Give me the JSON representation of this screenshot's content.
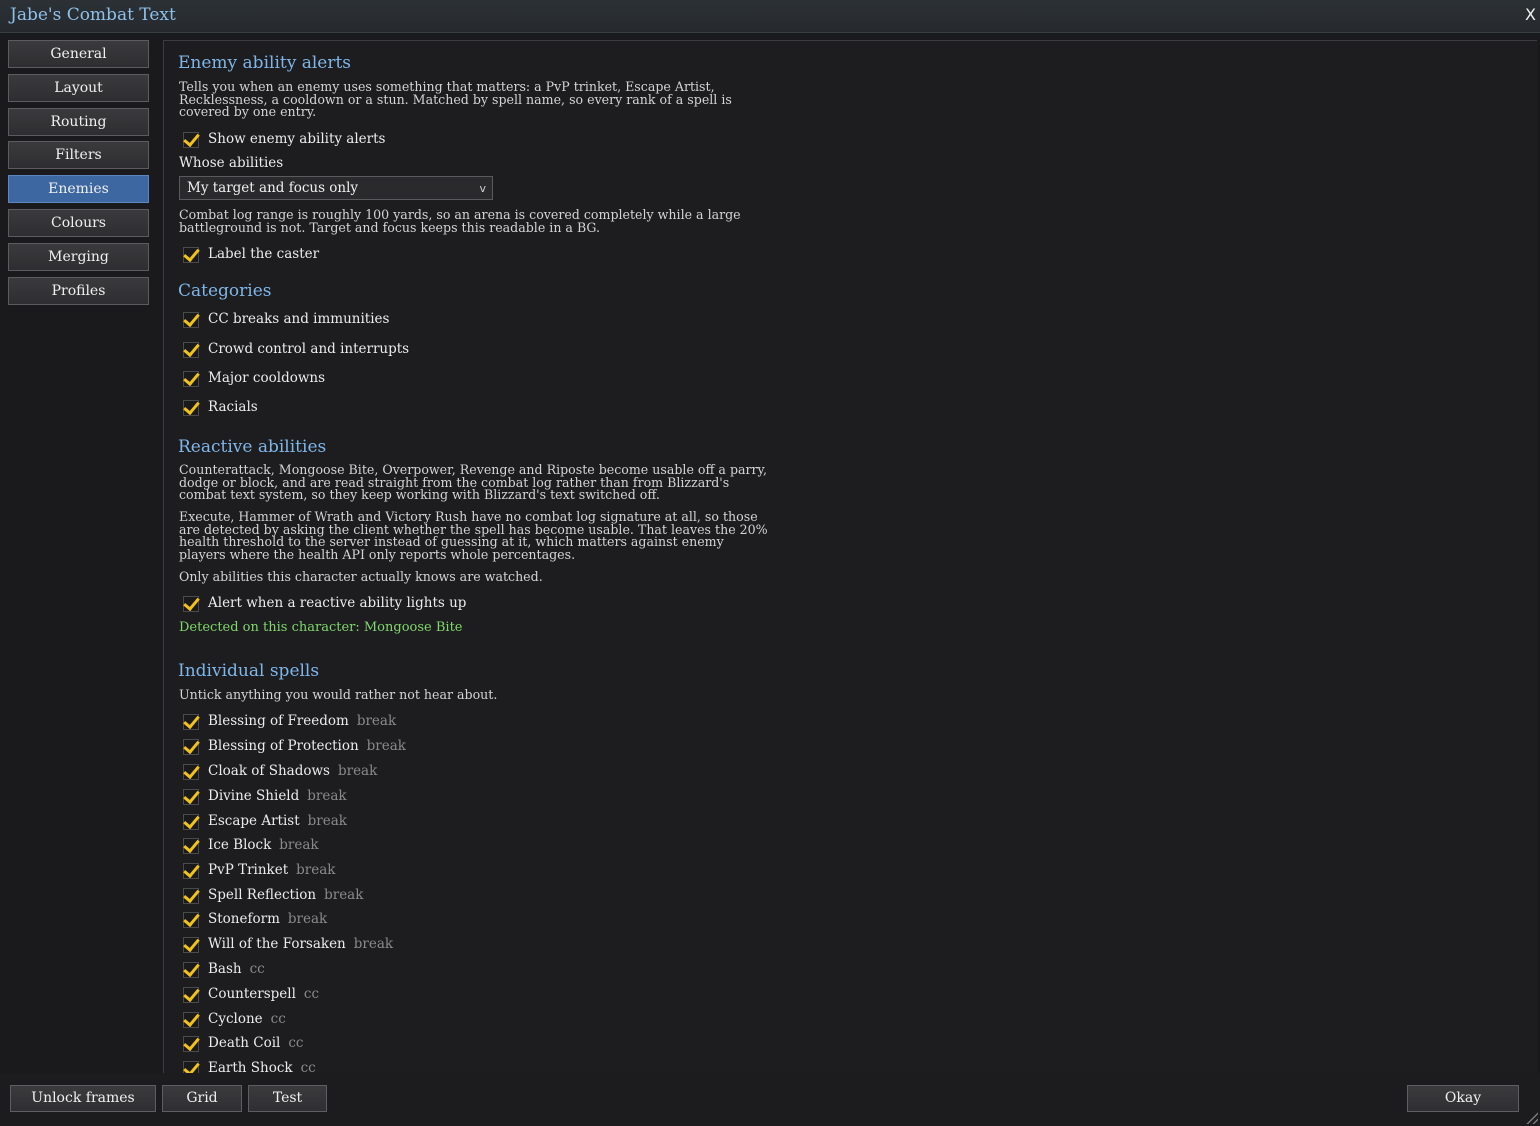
{
  "window": {
    "title": "Jabe's Combat Text",
    "close_label": "X"
  },
  "sidebar": {
    "items": [
      {
        "label": "General"
      },
      {
        "label": "Layout"
      },
      {
        "label": "Routing"
      },
      {
        "label": "Filters"
      },
      {
        "label": "Enemies",
        "active": true
      },
      {
        "label": "Colours"
      },
      {
        "label": "Merging"
      },
      {
        "label": "Profiles"
      }
    ]
  },
  "enemy_alerts": {
    "heading": "Enemy ability alerts",
    "description": "Tells you when an enemy uses something that matters: a PvP trinket, Escape Artist, Recklessness, a cooldown or a stun. Matched by spell name, so every rank of a spell is covered by one entry.",
    "show_label": "Show enemy ability alerts",
    "whose_label": "Whose abilities",
    "whose_value": "My target and focus only",
    "dropdown_arrow": "v",
    "range_note": "Combat log range is roughly 100 yards, so an arena is covered completely while a large battleground is not. Target and focus keeps this readable in a BG.",
    "label_caster": "Label the caster"
  },
  "categories": {
    "heading": "Categories",
    "items": [
      "CC breaks and immunities",
      "Crowd control and interrupts",
      "Major cooldowns",
      "Racials"
    ]
  },
  "reactive": {
    "heading": "Reactive abilities",
    "para1": "Counterattack, Mongoose Bite, Overpower, Revenge and Riposte become usable off a parry, dodge or block, and are read straight from the combat log rather than from Blizzard's combat text system, so they keep working with Blizzard's text switched off.",
    "para2": "Execute, Hammer of Wrath and Victory Rush have no combat log signature at all, so those are detected by asking the client whether the spell has become usable. That leaves the 20% health threshold to the server instead of guessing at it, which matters against enemy players where the health API only reports whole percentages.",
    "para3": "Only abilities this character actually knows are watched.",
    "alert_label": "Alert when a reactive ability lights up",
    "detected": "Detected on this character: Mongoose Bite"
  },
  "individual": {
    "heading": "Individual spells",
    "hint": "Untick anything you would rather not hear about.",
    "spells": [
      {
        "name": "Blessing of Freedom",
        "tag": "break"
      },
      {
        "name": "Blessing of Protection",
        "tag": "break"
      },
      {
        "name": "Cloak of Shadows",
        "tag": "break"
      },
      {
        "name": "Divine Shield",
        "tag": "break"
      },
      {
        "name": "Escape Artist",
        "tag": "break"
      },
      {
        "name": "Ice Block",
        "tag": "break"
      },
      {
        "name": "PvP Trinket",
        "tag": "break"
      },
      {
        "name": "Spell Reflection",
        "tag": "break"
      },
      {
        "name": "Stoneform",
        "tag": "break"
      },
      {
        "name": "Will of the Forsaken",
        "tag": "break"
      },
      {
        "name": "Bash",
        "tag": "cc"
      },
      {
        "name": "Counterspell",
        "tag": "cc"
      },
      {
        "name": "Cyclone",
        "tag": "cc"
      },
      {
        "name": "Death Coil",
        "tag": "cc"
      },
      {
        "name": "Earth Shock",
        "tag": "cc"
      }
    ]
  },
  "footer": {
    "unlock": "Unlock frames",
    "grid": "Grid",
    "test": "Test",
    "okay": "Okay"
  },
  "colors": {
    "accent": "#7fb6e8",
    "check": "#f1c21a",
    "active_tab": "#3d67a0",
    "detected": "#7fd86a"
  }
}
